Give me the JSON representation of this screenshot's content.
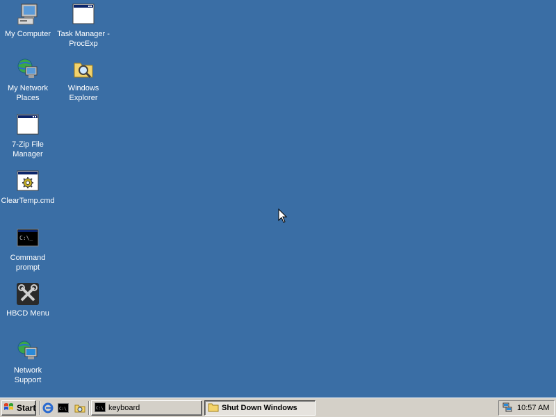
{
  "desktop": {
    "background": "#3a6ea5",
    "icons": [
      {
        "label": "My Computer",
        "icon": "computer-icon"
      },
      {
        "label": "Task Manager - ProcExp",
        "icon": "window-icon"
      },
      {
        "label": "My Network Places",
        "icon": "network-places-icon"
      },
      {
        "label": "Windows Explorer",
        "icon": "explorer-icon"
      },
      {
        "label": "7-Zip File Manager",
        "icon": "window-icon"
      },
      {
        "label": "ClearTemp.cmd",
        "icon": "batch-file-icon"
      },
      {
        "label": "Command prompt",
        "icon": "command-prompt-icon"
      },
      {
        "label": "HBCD Menu",
        "icon": "tools-icon"
      },
      {
        "label": "Network Support",
        "icon": "network-support-icon"
      }
    ]
  },
  "taskbar": {
    "start_label": "Start",
    "quick_launch": [
      "internet-explorer-icon",
      "command-prompt-icon",
      "explorer-icon"
    ],
    "tasks": [
      {
        "label": "keyboard",
        "icon": "command-prompt-icon",
        "active": false
      },
      {
        "label": "Shut Down Windows",
        "icon": "folder-icon",
        "active": true
      }
    ],
    "tray_icon": "network-tray-icon",
    "clock": "10:57 AM"
  }
}
